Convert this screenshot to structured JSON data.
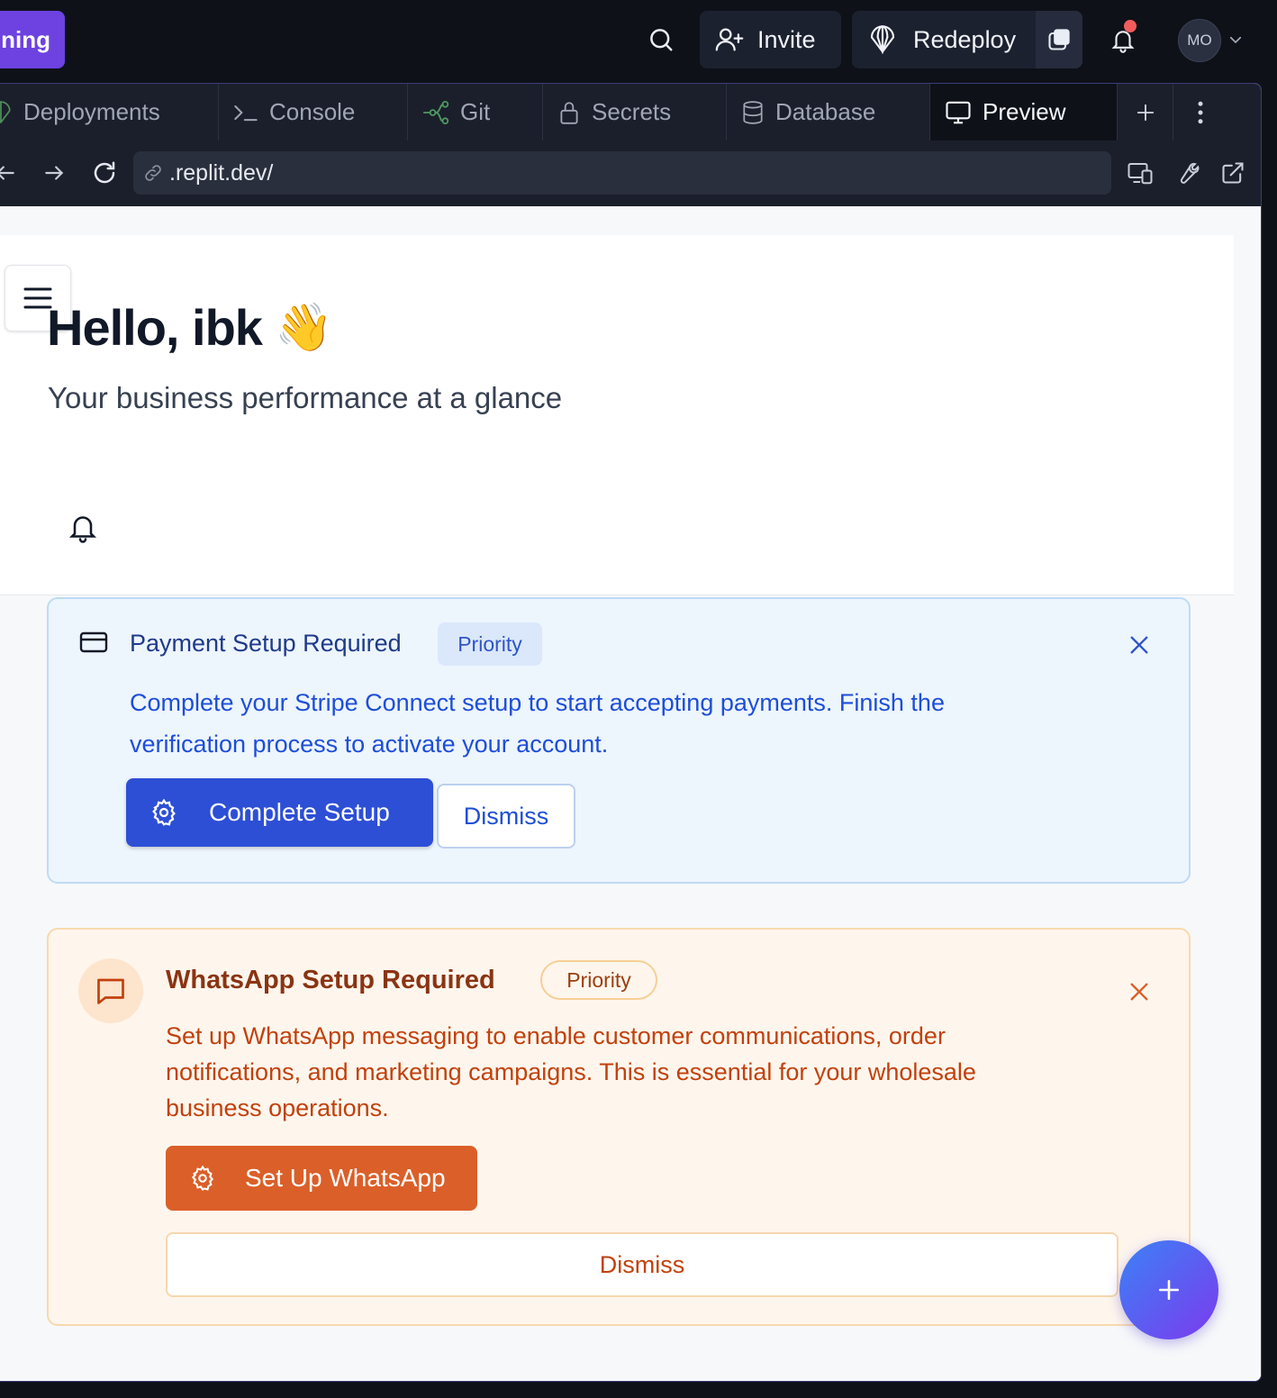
{
  "topbar": {
    "run_label": "ning",
    "invite_label": "Invite",
    "redeploy_label": "Redeploy",
    "avatar_initials": "MO"
  },
  "tabs": [
    {
      "label": "Deployments",
      "icon": "deployments-icon"
    },
    {
      "label": "Console",
      "icon": "console-icon"
    },
    {
      "label": "Git",
      "icon": "git-icon"
    },
    {
      "label": "Secrets",
      "icon": "lock-icon"
    },
    {
      "label": "Database",
      "icon": "database-icon"
    },
    {
      "label": "Preview",
      "icon": "monitor-icon",
      "active": true
    }
  ],
  "urlbar": {
    "url": ".replit.dev/"
  },
  "app": {
    "greeting": "Hello, ibk",
    "greeting_emoji": "👋",
    "subtitle": "Your business performance at a glance"
  },
  "payment_card": {
    "title": "Payment Setup Required",
    "badge": "Priority",
    "description": "Complete your Stripe Connect setup to start accepting payments. Finish the verification process to activate your account.",
    "primary_label": "Complete Setup",
    "dismiss_label": "Dismiss"
  },
  "whatsapp_card": {
    "title": "WhatsApp Setup Required",
    "badge": "Priority",
    "description": "Set up WhatsApp messaging to enable customer communications, order notifications, and marketing campaigns. This is essential for your wholesale business operations.",
    "primary_label": "Set Up WhatsApp",
    "dismiss_label": "Dismiss"
  },
  "colors": {
    "run_accent": "#6d42e0",
    "notification_dot": "#f25c5c",
    "payment_primary": "#2d4fd6",
    "whatsapp_primary": "#db5f29",
    "fab_gradient_start": "#3b82f6",
    "fab_gradient_end": "#7c3aed"
  }
}
